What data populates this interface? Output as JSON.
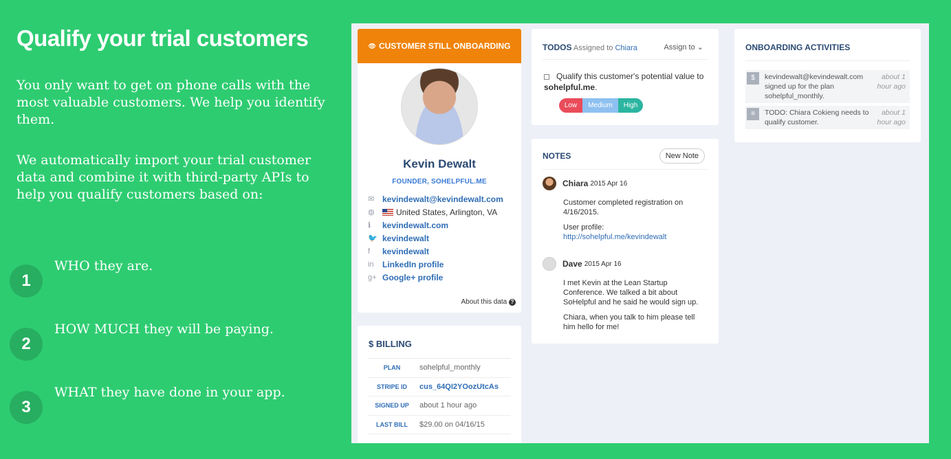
{
  "marketing": {
    "title": "Qualify your trial customers",
    "p1": "You only want to get on phone calls with the most valuable customers. We help you identify them.",
    "p2": "We automatically import your trial customer data and combine it with third-party APIs to help you qualify customers based on:",
    "points": [
      {
        "num": "1",
        "text": "WHO they are."
      },
      {
        "num": "2",
        "text": "HOW MUCH they will be paying."
      },
      {
        "num": "3",
        "text": "WHAT they have done in your app."
      }
    ]
  },
  "profile": {
    "banner": "CUSTOMER STILL ONBOARDING",
    "name": "Kevin Dewalt",
    "title": "FOUNDER, SOHELPFUL.ME",
    "email": "kevindewalt@kevindewalt.com",
    "location": "United States, Arlington, VA",
    "website": "kevindewalt.com",
    "twitter": "kevindewalt",
    "facebook": "kevindewalt",
    "linkedin": "LinkedIn profile",
    "googleplus": "Google+ profile",
    "about": "About this data"
  },
  "billing": {
    "title": "$ BILLING",
    "rows": [
      {
        "key": "PLAN",
        "value": "sohelpful_monthly"
      },
      {
        "key": "STRIPE ID",
        "value": "cus_64QI2YOozUtcAs"
      },
      {
        "key": "SIGNED UP",
        "value": "about 1 hour ago"
      },
      {
        "key": "LAST BILL",
        "value": "$29.00 on 04/16/15"
      }
    ]
  },
  "todos": {
    "title": "TODOS",
    "assigned_prefix": "Assigned to",
    "assignee": "Chiara",
    "assign_label": "Assign to",
    "item_text": "Qualify this customer's potential value to",
    "item_bold": "sohelpful.me",
    "item_suffix": ".",
    "levels": [
      "Low",
      "Medium",
      "High"
    ]
  },
  "notes": {
    "title": "NOTES",
    "new_note": "New Note",
    "items": [
      {
        "author": "Chiara",
        "date": "2015 Apr 16",
        "p1": "Customer completed registration on 4/16/2015.",
        "p2": "User profile:",
        "link": "http://sohelpful.me/kevindewalt"
      },
      {
        "author": "Dave",
        "date": "2015 Apr 16",
        "p1": "I met Kevin at the Lean Startup Conference. We talked a bit about SoHelpful and he said he would sign up.",
        "p2": "Chiara, when you talk to him please tell him hello for me!"
      }
    ]
  },
  "activities": {
    "title": "ONBOARDING ACTIVITIES",
    "items": [
      {
        "icon": "$",
        "text": "kevindewalt@kevindewalt.com signed up for the plan sohelpful_monthly.",
        "ago": "about 1 hour ago"
      },
      {
        "icon": "≡",
        "text": "TODO: Chiara Cokieng needs to qualify customer.",
        "ago": "about 1 hour ago"
      }
    ]
  },
  "colors": {
    "background": "#2ecc71",
    "banner": "#f0830a",
    "number_circle": "#27ae60",
    "link": "#2f6db5",
    "heading": "#2b4a73"
  }
}
